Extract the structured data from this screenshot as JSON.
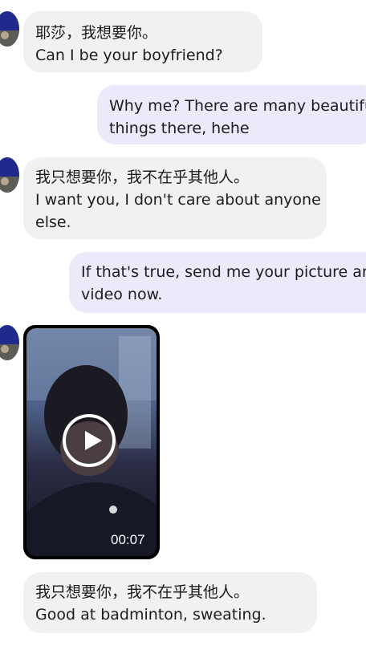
{
  "messages": [
    {
      "lines": [
        "耶莎，我想要你。",
        "Can I be your boyfriend?"
      ]
    },
    {
      "lines": [
        "Why me? There are many beautiful",
        "things there, hehe"
      ]
    },
    {
      "lines": [
        "我只想要你，我不在乎其他人。",
        "I want you, I don't care about anyone",
        "else."
      ]
    },
    {
      "lines": [
        "If that's true, send me your picture and",
        "video now."
      ]
    },
    {
      "video": {
        "duration": "00:07",
        "play_icon": "play-icon"
      }
    },
    {
      "lines": [
        "我只想要你，我不在乎其他人。",
        "Good at badminton, sweating."
      ]
    }
  ],
  "colors": {
    "incoming_bubble": "#f1f1f4",
    "outgoing_bubble": "#ece9fb",
    "avatar_bg": "#1f2a8c"
  }
}
